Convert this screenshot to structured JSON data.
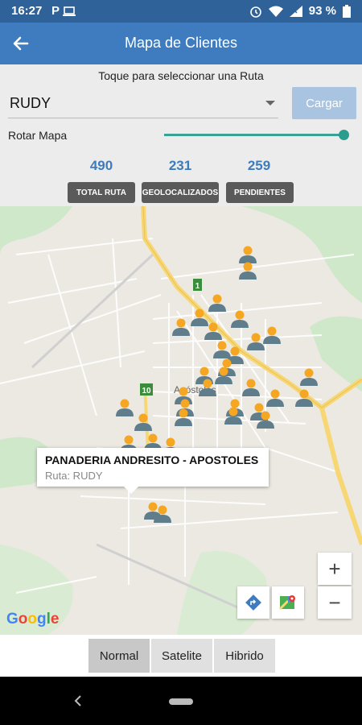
{
  "status_bar": {
    "time": "16:27",
    "left_icons": [
      "parking-icon",
      "laptop-icon"
    ],
    "right_icons": [
      "alarm-icon",
      "wifi-icon",
      "signal-icon"
    ],
    "battery": "93 %"
  },
  "app_bar": {
    "title": "Mapa de Clientes",
    "back_icon": "arrow-left-icon"
  },
  "route_panel": {
    "hint": "Toque para seleccionar una Ruta",
    "selected_route": "RUDY",
    "load_button": "Cargar",
    "rotate_label": "Rotar Mapa",
    "rotate_value": 1.0
  },
  "stats": [
    {
      "value": "490",
      "label": "TOTAL RUTA"
    },
    {
      "value": "231",
      "label": "GEOLOCALIZADOS"
    },
    {
      "value": "259",
      "label": "PENDIENTES"
    }
  ],
  "map": {
    "town_label": "Apóstoles",
    "road_shields": [
      "1",
      "10"
    ],
    "info_window": {
      "title": "PANADERIA ANDRESITO - APOSTOLES",
      "subtitle": "Ruta: RUDY"
    },
    "zoom_in": "+",
    "zoom_out": "−",
    "google_logo": "Google",
    "marker_icon": "person-marker-icon",
    "colors": {
      "marker_head": "#f5a623",
      "marker_body": "#607d8b",
      "road_major": "#f7d774",
      "park": "#cfe8c9",
      "background": "#ece9e2"
    }
  },
  "map_type_tabs": {
    "options": [
      "Normal",
      "Satelite",
      "Hibrido"
    ],
    "selected": "Normal"
  },
  "colors": {
    "accent": "#3e7cbf",
    "status_bar": "#2f6299",
    "stat_value": "#3c7cbc",
    "badge": "#5a5a5a",
    "slider": "#2a9d8f"
  }
}
